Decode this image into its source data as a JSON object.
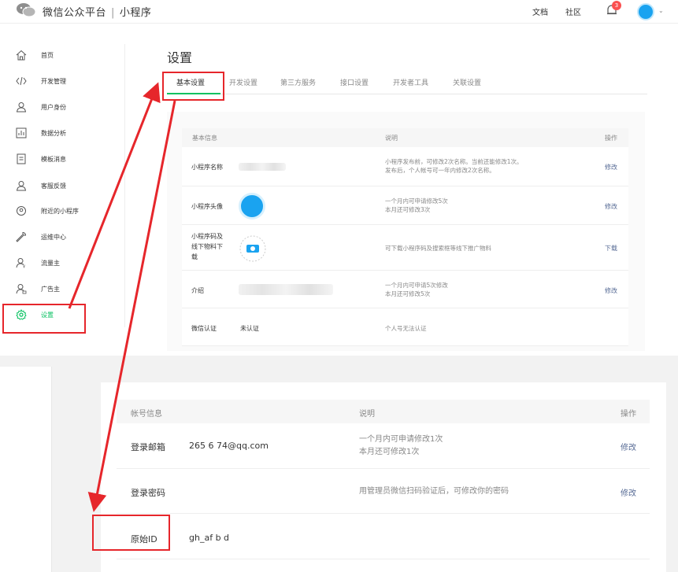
{
  "header": {
    "brand": "微信公众平台",
    "separator": "|",
    "section": "小程序",
    "links": {
      "docs": "文档",
      "community": "社区"
    },
    "notification_count": "3"
  },
  "sidebar": {
    "items": [
      {
        "label": "首页",
        "icon": "home-icon"
      },
      {
        "label": "开发管理",
        "icon": "code-icon"
      },
      {
        "label": "用户身份",
        "icon": "user-icon"
      },
      {
        "label": "数据分析",
        "icon": "chart-icon"
      },
      {
        "label": "模板消息",
        "icon": "document-icon"
      },
      {
        "label": "客服反馈",
        "icon": "support-icon"
      },
      {
        "label": "附近的小程序",
        "icon": "location-icon"
      },
      {
        "label": "运维中心",
        "icon": "wrench-icon"
      },
      {
        "label": "流量主",
        "icon": "traffic-icon"
      },
      {
        "label": "广告主",
        "icon": "advertiser-icon"
      },
      {
        "label": "设置",
        "icon": "gear-icon",
        "active": true
      }
    ]
  },
  "page": {
    "title": "设置",
    "tabs": [
      "基本设置",
      "开发设置",
      "第三方服务",
      "接口设置",
      "开发者工具",
      "关联设置"
    ]
  },
  "basic_info": {
    "headers": {
      "info": "基本信息",
      "desc": "说明",
      "op": "操作"
    },
    "rows": [
      {
        "label": "小程序名称",
        "value": "",
        "desc1": "小程序发布前，可修改2次名称。当前还能修改1次。",
        "desc2": "发布后，个人帐号可一年内修改2次名称。",
        "op": "修改"
      },
      {
        "label": "小程序头像",
        "desc1": "一个月内可申请修改5次",
        "desc2": "本月还可修改3次",
        "op": "修改"
      },
      {
        "label1": "小程序码及",
        "label2": "线下物料下",
        "label3": "载",
        "desc1": "可下载小程序码及搜索框等线下推广物料",
        "op": "下载"
      },
      {
        "label": "介绍",
        "desc1": "一个月内可申请5次修改",
        "desc2": "本月还可修改5次",
        "op": "修改"
      },
      {
        "label": "微信认证",
        "value": "未认证",
        "desc1": "个人号无法认证"
      }
    ]
  },
  "account_info": {
    "headers": {
      "info": "帐号信息",
      "desc": "说明",
      "op": "操作"
    },
    "rows": [
      {
        "label": "登录邮箱",
        "value": "265  6  74@qq.com",
        "desc1": "一个月内可申请修改1次",
        "desc2": "本月还可修改1次",
        "op": "修改"
      },
      {
        "label": "登录密码",
        "desc1": "用管理员微信扫码验证后，可修改你的密码",
        "op": "修改"
      },
      {
        "label": "原始ID",
        "value": "gh_af    b    d"
      }
    ]
  },
  "colors": {
    "accent": "#07c160",
    "link": "#576b95",
    "annotation": "#e6262b"
  }
}
